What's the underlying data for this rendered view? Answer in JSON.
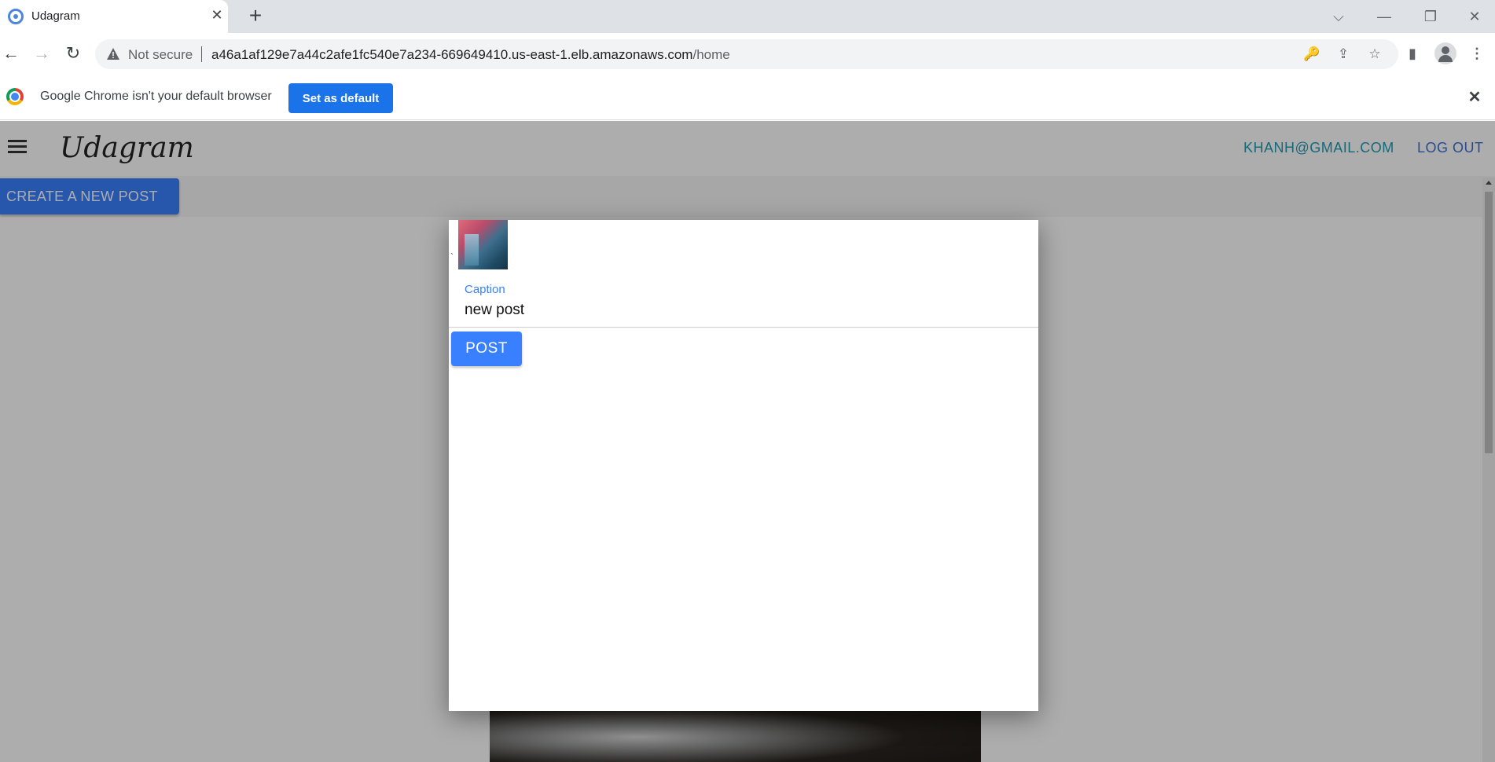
{
  "browser": {
    "tab": {
      "title": "Udagram",
      "close_glyph": "✕"
    },
    "new_tab_glyph": "+",
    "window_controls": {
      "tabsearch": "⌵",
      "minimize": "—",
      "restore": "❐",
      "close": "✕"
    },
    "nav": {
      "back": "←",
      "forward": "→",
      "reload": "↻"
    },
    "security_label": "Not secure",
    "url": {
      "host": "a46a1af129e7a44c2afe1fc540e7a234-669649410.us-east-1.elb.amazonaws.com",
      "path": "/home"
    },
    "omnibox_icons": {
      "key": "🔑",
      "share": "⇪",
      "bookmark": "☆"
    },
    "toolbar_icons": {
      "side_panel": "▮",
      "menu": "⋮"
    }
  },
  "infobar": {
    "message": "Google Chrome isn't your default browser",
    "button_label": "Set as default",
    "close_glyph": "✕"
  },
  "app": {
    "brand": "Udagram",
    "user_email": "KHANH@GMAIL.COM",
    "logout_label": "LOG OUT",
    "create_post_label": "CREATE A NEW POST"
  },
  "modal": {
    "stray_char": "`",
    "caption_label": "Caption",
    "caption_value": "new post",
    "post_button_label": "POST"
  },
  "colors": {
    "accent": "#3880ff",
    "email": "#1e9bb5",
    "chrome_blue": "#1a73e8"
  }
}
